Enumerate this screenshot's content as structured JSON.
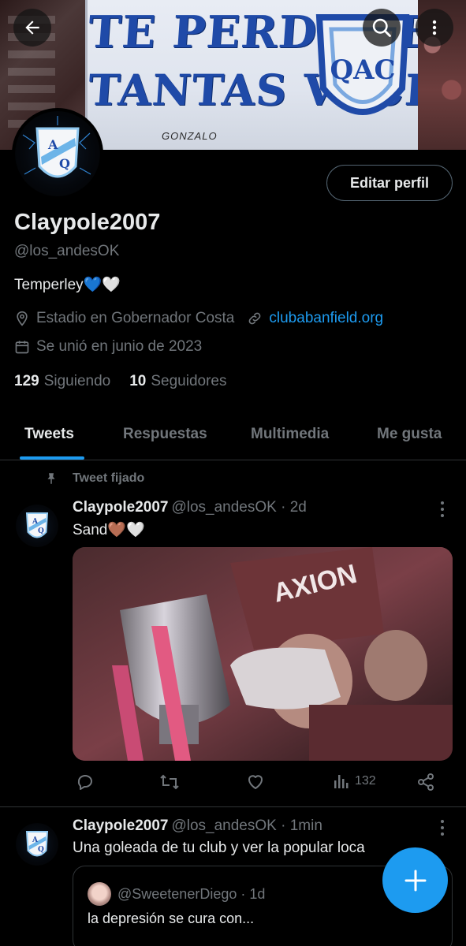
{
  "banner": {
    "line1": "TE PERDONE",
    "line2": "TANTAS VECES",
    "small": "GONZALO",
    "crest_text": "QAC"
  },
  "header_buttons": {
    "back": "arrow-left-icon",
    "search": "search-icon",
    "more": "more-vertical-icon"
  },
  "profile": {
    "edit_label": "Editar perfil",
    "name": "Claypole2007",
    "handle": "@los_andesOK",
    "bio": "Temperley💙🤍",
    "location": "Estadio en Gobernador Costa",
    "website": "clubabanfield.org",
    "joined": "Se unió en junio de 2023",
    "following_count": "129",
    "following_label": "Siguiendo",
    "followers_count": "10",
    "followers_label": "Seguidores",
    "avatar_text": "A Q"
  },
  "tabs": [
    {
      "label": "Tweets",
      "active": true
    },
    {
      "label": "Respuestas",
      "active": false
    },
    {
      "label": "Multimedia",
      "active": false
    },
    {
      "label": "Me gusta",
      "active": false
    }
  ],
  "pinned_label": "Tweet fijado",
  "tweets": [
    {
      "name": "Claypole2007",
      "meta": "@los_andesOK · 2d",
      "text": "Sand🤎🤍",
      "views": "132",
      "photo_text": "AXION"
    },
    {
      "name": "Claypole2007",
      "meta": "@los_andesOK · 1min",
      "text": "Una goleada de tu club y ver la popular loca",
      "quote": {
        "meta": "@SweetenerDiego · 1d",
        "text": "la depresión se cura con..."
      }
    }
  ],
  "colors": {
    "accent": "#1d9bf0",
    "background": "#000000",
    "text": "#e7e9ea",
    "muted": "#71767b",
    "border": "#2f3336"
  }
}
